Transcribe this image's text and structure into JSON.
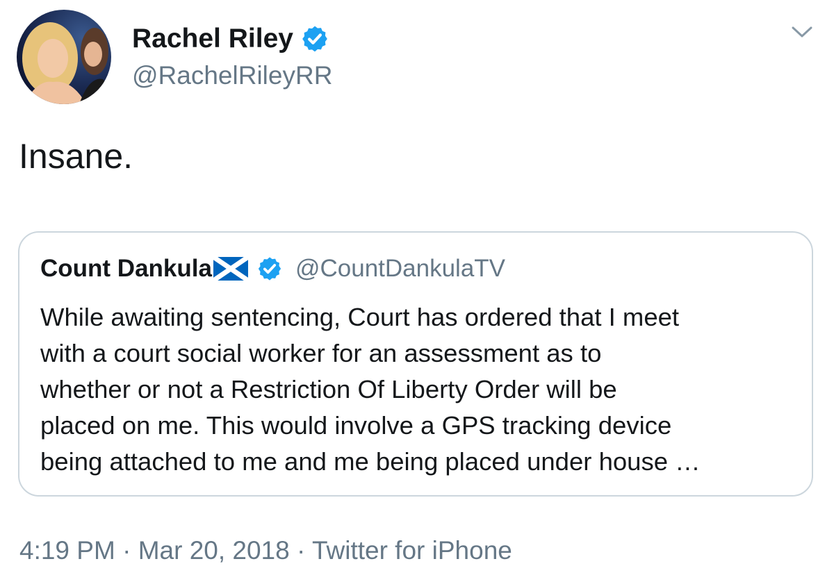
{
  "author": {
    "display_name": "Rachel Riley",
    "handle": "@RachelRileyRR",
    "verified": true,
    "avatar_icon": "profile-photo"
  },
  "tweet": {
    "text": "Insane."
  },
  "quoted_tweet": {
    "display_name": "Count Dankula",
    "flag_icon": "scotland-flag-icon",
    "verified": true,
    "handle": "@CountDankulaTV",
    "lines": [
      "While awaiting sentencing, Court has ordered that I meet",
      "with a court social worker for an assessment as to",
      "whether or not a Restriction Of Liberty Order will be",
      "placed on me. This would involve a GPS tracking device",
      "being attached to me and me being placed under house …"
    ]
  },
  "meta": {
    "time": "4:19 PM",
    "separator": " · ",
    "date": "Mar 20, 2018",
    "source": "Twitter for iPhone"
  },
  "colors": {
    "verified_blue": "#1da1f2",
    "secondary_text": "#657786",
    "border": "#ccd6dd"
  }
}
